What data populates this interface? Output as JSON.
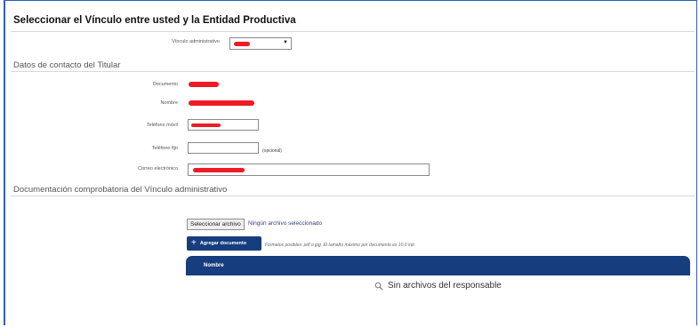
{
  "header": {
    "title": "Seleccionar el Vínculo entre usted y la Entidad Productiva"
  },
  "vinculo": {
    "label": "Vínculo administrativo",
    "selected": "Titular",
    "caret_icon": "chevron-down-icon"
  },
  "contacto": {
    "section_title": "Datos de contacto del Titular",
    "documento_label": "Documento",
    "nombre_label": "Nombre",
    "telefono_movil_label": "Teléfono móvil",
    "telefono_fijo_label": "Teléfono fijo",
    "telefono_fijo_value": "",
    "opcional_note": "(opcional)",
    "correo_label": "Correo electrónico"
  },
  "documentacion": {
    "section_title": "Documentación comprobatoria del Vínculo administrativo",
    "file_button_label": "Seleccionar archivo",
    "file_status": "Ningún archivo seleccionado",
    "add_button_label": "Agregar documento",
    "add_icon": "plus-icon",
    "formats_hint": "Formatos posibles: pdf o jpg. El tamaño máximo por documento es 10.0 mb",
    "table_column": "Nombre",
    "empty_message": "Sin archivos del responsable",
    "empty_icon": "magnifier-icon"
  },
  "colors": {
    "accent": "#163e7e",
    "redaction": "#ee1b24",
    "frame": "#2f5fb3"
  }
}
